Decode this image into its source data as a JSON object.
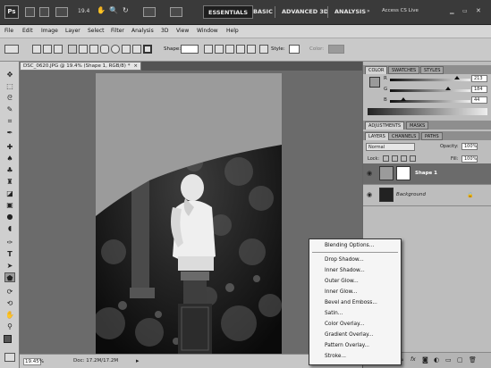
{
  "appbar": {
    "logo": "Ps",
    "zoom": "19.4",
    "workspaces": [
      "ESSENTIALS",
      "BASIC",
      "ADVANCED 3D",
      "ANALYSIS"
    ],
    "more": "»",
    "cs_live": "Access CS Live"
  },
  "menus": [
    "File",
    "Edit",
    "Image",
    "Layer",
    "Select",
    "Filter",
    "Analysis",
    "3D",
    "View",
    "Window",
    "Help"
  ],
  "options": {
    "shape_label": "Shape:",
    "style_label": "Style:",
    "color_label": "Color:"
  },
  "document": {
    "tab_title": "DSC_0620.JPG @ 19.4% (Shape 1, RGB/8) *",
    "close": "×"
  },
  "status": {
    "zoom": "19.45%",
    "doc": "Doc: 17.2M/17.2M"
  },
  "color_panel": {
    "tabs": [
      "COLOR",
      "SWATCHES",
      "STYLES"
    ],
    "channels": [
      {
        "label": "R",
        "value": "213",
        "fraction": 0.835
      },
      {
        "label": "G",
        "value": "184",
        "fraction": 0.72
      },
      {
        "label": "B",
        "value": "44",
        "fraction": 0.17
      }
    ]
  },
  "adjust_panel": {
    "tabs": [
      "ADJUSTMENTS",
      "MASKS"
    ]
  },
  "layers_panel": {
    "tabs": [
      "LAYERS",
      "CHANNELS",
      "PATHS"
    ],
    "blend_mode": "Normal",
    "opacity_label": "Opacity:",
    "opacity": "100%",
    "lock_label": "Lock:",
    "fill_label": "Fill:",
    "fill": "100%",
    "layers": [
      {
        "name": "Shape 1",
        "selected": true
      },
      {
        "name": "Background",
        "selected": false
      }
    ]
  },
  "context_menu": {
    "items": [
      "Blending Options...",
      "Drop Shadow...",
      "Inner Shadow...",
      "Outer Glow...",
      "Inner Glow...",
      "Bevel and Emboss...",
      "Satin...",
      "Color Overlay...",
      "Gradient Overlay...",
      "Pattern Overlay...",
      "Stroke..."
    ]
  },
  "icons": [
    "move-icon",
    "marquee-icon",
    "lasso-icon",
    "quick-select-icon",
    "crop-icon",
    "eyedropper-icon",
    "healing-icon",
    "brush-icon",
    "stamp-icon",
    "history-brush-icon",
    "eraser-icon",
    "gradient-icon",
    "blur-icon",
    "dodge-icon",
    "pen-icon",
    "type-icon",
    "path-select-icon",
    "shape-icon",
    "3d-rotate-icon",
    "3d-camera-icon",
    "hand-icon",
    "zoom-icon"
  ]
}
